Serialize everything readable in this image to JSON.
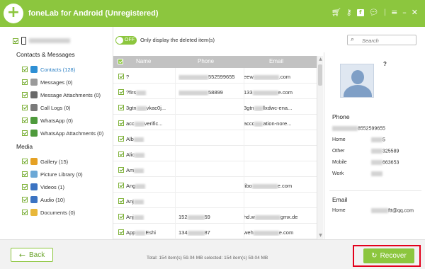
{
  "app": {
    "title": "foneLab for Android (Unregistered)"
  },
  "titlebar_icons": [
    "cart-icon",
    "key-icon",
    "facebook-icon",
    "chat-icon",
    "menu-icon",
    "minimize-icon",
    "close-icon"
  ],
  "toolbar": {
    "toggle_state": "OFF",
    "toggle_label": "Only display the deleted item(s)",
    "search_placeholder": "Search"
  },
  "sidebar": {
    "section_contacts": "Contacts & Messages",
    "contacts_items": [
      {
        "label": "Contacts (128)",
        "icon": "contacts-icon",
        "color": "#2e8fd4",
        "active": true
      },
      {
        "label": "Messages (0)",
        "icon": "messages-icon",
        "color": "#9a9a9a"
      },
      {
        "label": "Message Attachments (0)",
        "icon": "attachment-icon",
        "color": "#6a6a6a"
      },
      {
        "label": "Call Logs (0)",
        "icon": "call-logs-icon",
        "color": "#7a7a7a"
      },
      {
        "label": "WhatsApp (0)",
        "icon": "whatsapp-icon",
        "color": "#4e9a3c"
      },
      {
        "label": "WhatsApp Attachments (0)",
        "icon": "whatsapp-attachment-icon",
        "color": "#4e9a3c"
      }
    ],
    "section_media": "Media",
    "media_items": [
      {
        "label": "Gallery (15)",
        "icon": "gallery-icon",
        "color": "#e5a124"
      },
      {
        "label": "Picture Library (0)",
        "icon": "picture-library-icon",
        "color": "#6ca8d6"
      },
      {
        "label": "Videos (1)",
        "icon": "videos-icon",
        "color": "#3b73c2"
      },
      {
        "label": "Audio (10)",
        "icon": "audio-icon",
        "color": "#3b73c2"
      },
      {
        "label": "Documents (0)",
        "icon": "documents-icon",
        "color": "#e8b73a"
      }
    ]
  },
  "table": {
    "headers": {
      "name": "Name",
      "phone": "Phone",
      "email": "Email"
    },
    "rows": [
      {
        "name": "?",
        "phone": "552599655",
        "email": "eew",
        "email_tail": ".com"
      },
      {
        "name": "?firs",
        "phone": "58899",
        "email": "133",
        "email_tail": "e.com"
      },
      {
        "name": "3gtn",
        "name_tail": "vkac0j...",
        "phone": "",
        "email": "3gtn",
        "email_tail": "llxdwc-ena..."
      },
      {
        "name": "acc",
        "name_tail": "verific...",
        "phone": "",
        "email": "accc",
        "email_tail": "ation-nore..."
      },
      {
        "name": "Alb",
        "phone": "",
        "email": ""
      },
      {
        "name": "Alic",
        "phone": "",
        "email": ""
      },
      {
        "name": "Am",
        "phone": "",
        "email": ""
      },
      {
        "name": "Ang",
        "phone": "",
        "email": "libo",
        "email_tail": "e.com"
      },
      {
        "name": "Anj",
        "phone": "",
        "email": ""
      },
      {
        "name": "Anj",
        "phone_head": "152",
        "phone": "59",
        "email": "hd.w",
        "email_tail": "gmx.de"
      },
      {
        "name": "App",
        "name_tail": "Eshi",
        "phone_head": "134",
        "phone": "87",
        "email": "weh",
        "email_tail": "e.com"
      }
    ]
  },
  "detail": {
    "name": "?",
    "phone_title": "Phone",
    "phones": [
      {
        "label": "",
        "value": "8552599655"
      },
      {
        "label": "Home",
        "value": "5"
      },
      {
        "label": "Other",
        "value": "325589"
      },
      {
        "label": "Mobile",
        "value": "663653"
      },
      {
        "label": "Work",
        "value": ""
      }
    ],
    "email_title": "Email",
    "emails": [
      {
        "label": "Home",
        "value": "ftt@qq.com"
      }
    ]
  },
  "footer": {
    "back_label": "Back",
    "totals": "Total: 154 item(s) 59.04 MB   selected: 154 item(s) 59.04 MB",
    "recover_label": "Recover"
  }
}
